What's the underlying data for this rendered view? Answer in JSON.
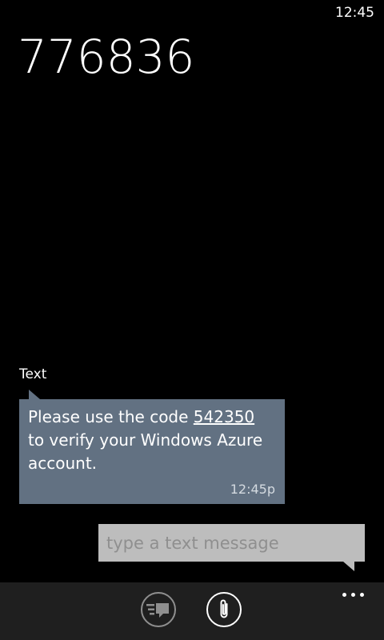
{
  "status_bar": {
    "time": "12:45"
  },
  "thread": {
    "title": "776836"
  },
  "message": {
    "label": "Text",
    "text_before": "Please use the code ",
    "code": "542350",
    "text_after": " to verify your Windows Azure account.",
    "time": "12:45p",
    "bubble_color": "#627182"
  },
  "compose": {
    "placeholder": "type a text message",
    "value": ""
  },
  "app_bar": {
    "buttons": [
      {
        "icon": "switch-conversation-icon"
      },
      {
        "icon": "attach-icon"
      }
    ],
    "more_icon": "more-icon"
  }
}
